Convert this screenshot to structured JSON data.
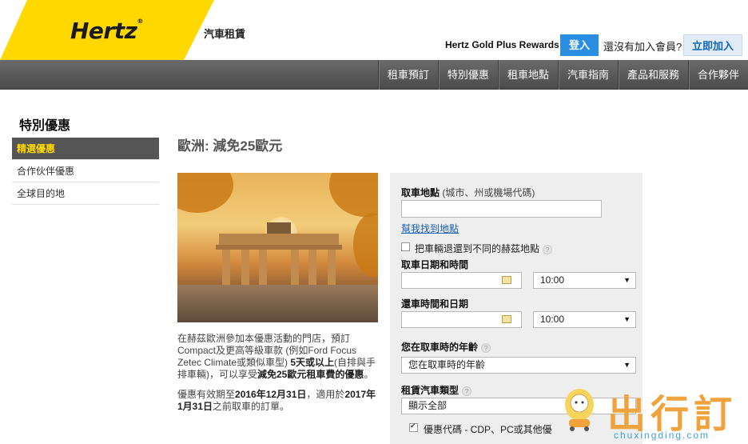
{
  "header": {
    "logo": "Hertz",
    "logo_mark": "®",
    "subtitle": "汽車租賃",
    "gold_plus": "Hertz Gold Plus Rewards",
    "login_label": "登入",
    "not_member": "還沒有加入會員?",
    "join_label": "立即加入",
    "accent_color": "#ffd800"
  },
  "nav": {
    "items": [
      {
        "label": "租車預訂"
      },
      {
        "label": "特別優惠"
      },
      {
        "label": "租車地點"
      },
      {
        "label": "汽車指南"
      },
      {
        "label": "產品和服務"
      },
      {
        "label": "合作夥伴"
      }
    ]
  },
  "sidebar": {
    "title": "特別優惠",
    "items": [
      {
        "label": "精選優惠",
        "active": true
      },
      {
        "label": "合作伙伴優惠"
      },
      {
        "label": "全球目的地"
      }
    ]
  },
  "main": {
    "title": "歐洲: 減免25歐元",
    "desc1_a": "在赫茲歐洲參加本優惠活動的門店，預訂Compact及更高等級車款 (例如Ford Focus Zetec Climate或類似車型) ",
    "desc1_b": "5天或以上",
    "desc1_c": "(自排與手排車輛)，可以享受",
    "desc1_d": "減免25歐元租車費的優惠",
    "desc1_e": "。",
    "desc2_a": "優惠有效期至",
    "desc2_b": "2016年12月31日",
    "desc2_c": "，適用於",
    "desc2_d": "2017年1月31日",
    "desc2_e": "之前取車的訂單。"
  },
  "form": {
    "pickup_label": "取車地點",
    "pickup_hint": "(城市、州或機場代碼)",
    "pickup_value": "",
    "help_link": "幫我找到地點",
    "return_diff_label": "把車輛退還到不同的赫茲地點",
    "pickup_dt_label": "取車日期和時間",
    "pickup_time": "10:00",
    "return_dt_label": "還車時間和日期",
    "return_time": "10:00",
    "age_label": "您在取車時的年齡",
    "age_value": "您在取車時的年齡",
    "car_type_label": "租賃汽車類型",
    "car_type_value": "顯示全部",
    "promo_label": "優惠代碼 - CDP、PC或其他優"
  },
  "watermark": {
    "text": "出行訂",
    "url": "chuxingding.com"
  }
}
